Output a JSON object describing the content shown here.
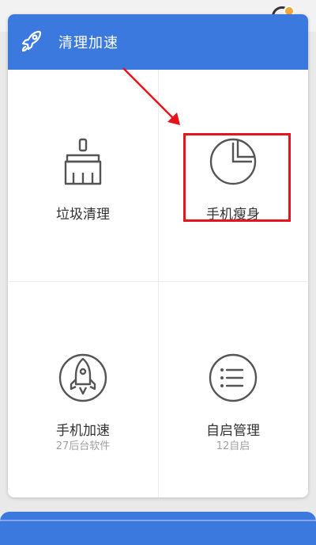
{
  "header": {
    "title": "清理加速",
    "icon": "rocket-icon"
  },
  "tiles": [
    {
      "label": "垃圾清理",
      "icon": "broom-icon"
    },
    {
      "label": "手机瘦身",
      "icon": "pie-chart-icon"
    },
    {
      "label": "手机加速",
      "sub": "27后台软件",
      "icon": "rocket-circle-icon"
    },
    {
      "label": "自启管理",
      "sub": "12自启",
      "icon": "list-circle-icon"
    }
  ],
  "colors": {
    "brand": "#3b79de",
    "highlight": "#e8141b"
  }
}
